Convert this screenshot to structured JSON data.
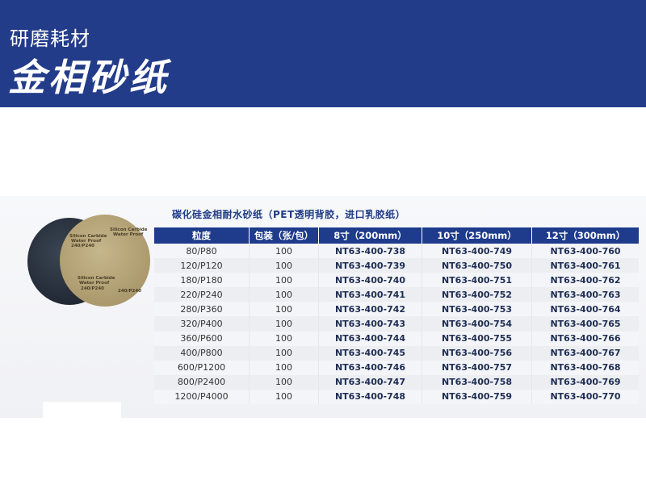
{
  "banner": {
    "subtitle": "研磨耗材",
    "title": "金相砂纸"
  },
  "product": {
    "caption": "碳化硅金相耐水砂纸（PET透明背胶，进口乳胶纸）",
    "disc_label_lines": [
      "Silicon Carbide",
      "Water Proof",
      "240/P240"
    ],
    "colors": {
      "gold_disc": "#b7a679",
      "black_disc": "#2a3340"
    }
  },
  "table": {
    "headers": [
      "粒度",
      "包装（张/包）",
      "8寸（200mm）",
      "10寸（250mm）",
      "12寸（300mm）"
    ],
    "rows": [
      [
        "80/P80",
        "100",
        "NT63-400-738",
        "NT63-400-749",
        "NT63-400-760"
      ],
      [
        "120/P120",
        "100",
        "NT63-400-739",
        "NT63-400-750",
        "NT63-400-761"
      ],
      [
        "180/P180",
        "100",
        "NT63-400-740",
        "NT63-400-751",
        "NT63-400-762"
      ],
      [
        "220/P240",
        "100",
        "NT63-400-741",
        "NT63-400-752",
        "NT63-400-763"
      ],
      [
        "280/P360",
        "100",
        "NT63-400-742",
        "NT63-400-753",
        "NT63-400-764"
      ],
      [
        "320/P400",
        "100",
        "NT63-400-743",
        "NT63-400-754",
        "NT63-400-765"
      ],
      [
        "360/P600",
        "100",
        "NT63-400-744",
        "NT63-400-755",
        "NT63-400-766"
      ],
      [
        "400/P800",
        "100",
        "NT63-400-745",
        "NT63-400-756",
        "NT63-400-767"
      ],
      [
        "600/P1200",
        "100",
        "NT63-400-746",
        "NT63-400-757",
        "NT63-400-768"
      ],
      [
        "800/P2400",
        "100",
        "NT63-400-747",
        "NT63-400-758",
        "NT63-400-769"
      ],
      [
        "1200/P4000",
        "100",
        "NT63-400-748",
        "NT63-400-759",
        "NT63-400-770"
      ]
    ]
  },
  "colors": {
    "banner_blue": "#233c8a",
    "header_blue": "#1e3b8c",
    "caption_blue": "#1f3b86"
  }
}
